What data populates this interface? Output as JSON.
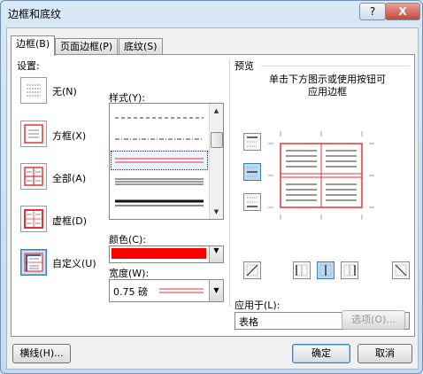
{
  "window": {
    "title": "边框和底纹",
    "help_label": "?",
    "close_label": "X"
  },
  "tabs": [
    {
      "label": "边框(B)",
      "active": true
    },
    {
      "label": "页面边框(P)",
      "active": false
    },
    {
      "label": "底纹(S)",
      "active": false
    }
  ],
  "settings": {
    "header": "设置:",
    "items": [
      {
        "label": "无(N)",
        "selected": false
      },
      {
        "label": "方框(X)",
        "selected": false
      },
      {
        "label": "全部(A)",
        "selected": false
      },
      {
        "label": "虚框(D)",
        "selected": false
      },
      {
        "label": "自定义(U)",
        "selected": true
      }
    ]
  },
  "style_list": {
    "header": "样式(Y):",
    "selected_index": 2,
    "up_arrow": "▲",
    "down_arrow": "▼"
  },
  "color": {
    "label": "颜色(C):",
    "value_hex": "#ff0000",
    "dropdown_arrow": "▼"
  },
  "width": {
    "label": "宽度(W):",
    "value": "0.75 磅",
    "dropdown_arrow": "▼"
  },
  "preview": {
    "header": "预览",
    "instruction_line1": "单击下方图示或使用按钮可",
    "instruction_line2": "应用边框",
    "border_color_hex": "#e8323a"
  },
  "apply_to": {
    "label": "应用于(L):",
    "value": "表格",
    "dropdown_arrow": "▼"
  },
  "buttons": {
    "options": "选项(O)...",
    "horizontal_line": "横线(H)...",
    "ok": "确定",
    "cancel": "取消"
  }
}
